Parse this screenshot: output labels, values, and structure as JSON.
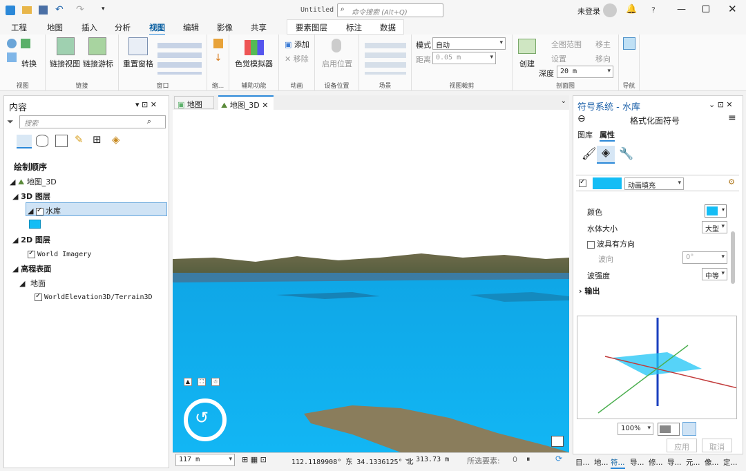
{
  "titlebar": {
    "doc_title": "Untitled",
    "search_placeholder": "命令搜索 (Alt+Q)",
    "user": "未登录",
    "help": "?"
  },
  "ribbon_tabs": [
    "工程",
    "地图",
    "插入",
    "分析",
    "视图",
    "编辑",
    "影像",
    "共享"
  ],
  "active_tab": "视图",
  "context_tabs": [
    "要素图层",
    "标注",
    "数据"
  ],
  "ribbon": {
    "view_group": {
      "label": "视图",
      "convert": "转换"
    },
    "link_group": {
      "label": "链接",
      "link_view": "链接视图",
      "link_cursor": "链接游标"
    },
    "window_group": {
      "label": "窗口",
      "reset": "重置窗格"
    },
    "zoom_group": {
      "label": "缩..."
    },
    "accessibility": {
      "label": "辅助功能",
      "simulator": "色觉模拟器"
    },
    "animation": {
      "label": "动画",
      "add": "添加",
      "remove": "移除"
    },
    "device": {
      "label": "设备位置",
      "enable": "启用位置"
    },
    "scene": {
      "label": "场景"
    },
    "clip": {
      "label": "视图裁剪",
      "mode_label": "模式",
      "mode_value": "自动",
      "distance_label": "距离",
      "distance_value": "0.05  m"
    },
    "profile": {
      "label": "剖面图",
      "create": "创建",
      "full_extent": "全图范围",
      "settings": "设置",
      "move": "移主",
      "move_dir": "移向",
      "depth_label": "深度",
      "depth_value": "20 m"
    },
    "nav": {
      "label": "导航"
    }
  },
  "contents": {
    "title": "内容",
    "search_placeholder": "搜索",
    "draw_order": "绘制顺序",
    "map_name": "地图_3D",
    "layers3d": "3D 图层",
    "reservoir": "水库",
    "layers2d": "2D 图层",
    "imagery": "World Imagery",
    "elevation": "高程表面",
    "ground": "地面",
    "terrain": "WorldElevation3D/Terrain3D"
  },
  "map_tabs": [
    "地图",
    "地图_3D"
  ],
  "statusbar": {
    "scale": "117 m",
    "coords": "112.1189908° 东 34.1336125° 北",
    "elev": "313.73 m",
    "selected_label": "所选要素:",
    "selected_count": "0"
  },
  "symbology": {
    "title": "符号系统 - 水库",
    "subtitle": "格式化面符号",
    "tab_gallery": "图库",
    "tab_props": "属性",
    "fill_type": "动画填充",
    "color_label": "颜色",
    "color": "#14bdf5",
    "wave_size_label": "水体大小",
    "wave_size": "大型",
    "directional_label": "波具有方向",
    "direction_label": "波向",
    "direction_value": "0°",
    "strength_label": "波强度",
    "strength": "中等",
    "output_label": "输出",
    "zoom": "100%",
    "apply": "应用",
    "cancel": "取消"
  },
  "bottom_tabs": [
    "目...",
    "地...",
    "符...",
    "导...",
    "修...",
    "导...",
    "元...",
    "像...",
    "定..."
  ],
  "colors": {
    "water": "#0fb0f0",
    "accent": "#2b88d8",
    "tab_active": "#005a9e"
  }
}
